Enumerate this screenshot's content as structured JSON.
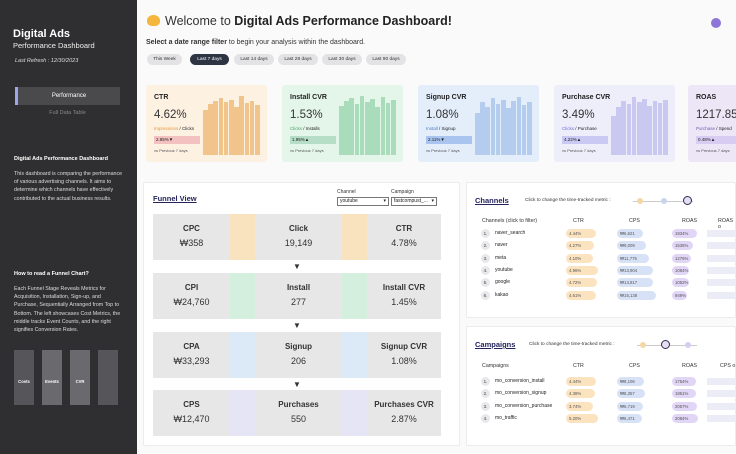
{
  "sidebar": {
    "title": "Digital Ads",
    "subtitle": "Performance Dashboard",
    "last_refresh": "Last Refresh : 12/30/2023",
    "nav": [
      "Performance",
      "Full Data Table"
    ],
    "about_title": "Digital Ads Performance Dashboard",
    "about_text": "This dashboard is comparing the performance of various advertising channels. It aims to determine which channels have effectively contributed to the actual business results.",
    "funnel_title": "How to read a Funnel Chart?",
    "funnel_text": "Each Funnel Stage Reveals Metrics for Acquisition, Installation, Sign-up, and Purchase, Sequentially Arranged from Top to Bottom. The left showcases Cost Metrics, the middle tracks Event Counts, and the right signifies Conversion Rates.",
    "mini_labels": [
      "Costs",
      "Events",
      "CVR"
    ]
  },
  "header": {
    "welcome_prefix": "Welcome to",
    "welcome_title": "Digital Ads Performance Dashboard!",
    "range_bold": "Select a date range filter",
    "range_rest": "to begin your analysis within the dashboard.",
    "ranges": [
      "This Week",
      "Last 7 days",
      "Last 14 days",
      "Last 28 days",
      "Last 30 days",
      "Last 90 days"
    ],
    "active_range": "Last 7 days"
  },
  "kpis": [
    {
      "name": "CTR",
      "value": "4.62%",
      "sub_a": "Impressions",
      "sub_b": "Clicks",
      "chip": "2.85%▼",
      "vs": "vs Previous 7 days",
      "bg": "#fdf1e2",
      "bar": "#f1c48c",
      "chipbg": "#f4c1c1",
      "accent": "#e39a3a",
      "bars": [
        0.75,
        0.85,
        0.9,
        0.95,
        0.88,
        0.92,
        0.8,
        0.98,
        0.86,
        0.9,
        0.83
      ]
    },
    {
      "name": "Install CVR",
      "value": "1.53%",
      "sub_a": "Clicks",
      "sub_b": "Installs",
      "chip": "1.95%▲",
      "vs": "vs Previous 7 days",
      "bg": "#e4f6ea",
      "bar": "#a9dcba",
      "chipbg": "#b6ddc5",
      "accent": "#4a9e64",
      "bars": [
        0.82,
        0.9,
        0.95,
        0.85,
        0.98,
        0.88,
        0.93,
        0.8,
        0.96,
        0.87,
        0.91
      ]
    },
    {
      "name": "Signup CVR",
      "value": "1.08%",
      "sub_a": "Install",
      "sub_b": "Signup",
      "chip": "2.11%▼",
      "vs": "vs Previous 7 days",
      "bg": "#e4eefb",
      "bar": "#b4cdef",
      "chipbg": "#a9c5ef",
      "accent": "#4f7cc8",
      "bars": [
        0.7,
        0.88,
        0.8,
        0.95,
        0.85,
        0.92,
        0.78,
        0.9,
        0.97,
        0.83,
        0.88
      ]
    },
    {
      "name": "Purchase CVR",
      "value": "3.49%",
      "sub_a": "Clicks",
      "sub_b": "Purchase",
      "chip": "4.22%▲",
      "vs": "vs Previous 7 days",
      "bg": "#eeeefb",
      "bar": "#c8c8f0",
      "chipbg": "#c9c9f3",
      "accent": "#6a6ad0",
      "bars": [
        0.65,
        0.8,
        0.9,
        0.85,
        0.97,
        0.88,
        0.94,
        0.82,
        0.9,
        0.86,
        0.92
      ]
    },
    {
      "name": "ROAS",
      "value": "1217.85%",
      "sub_a": "Purchase",
      "sub_b": "Spend",
      "chip": "0.48%▲",
      "vs": "vs Previous 7 days",
      "bg": "#ece6f7",
      "bar": "#d3c6ee",
      "chipbg": "#d9ccf3",
      "accent": "#7a59b8",
      "bars": []
    }
  ],
  "funnel": {
    "title": "Funnel View",
    "channel_label": "Channel",
    "channel_value": "youtube",
    "campaign_label": "Campaign",
    "campaign_value": "fastcompust_...",
    "rows": [
      {
        "cost_label": "CPC",
        "cost_value": "₩358",
        "event_label": "Click",
        "event_value": "19,149",
        "rate_label": "CTR",
        "rate_value": "4.78%",
        "accent": "#f8e3be"
      },
      {
        "cost_label": "CPI",
        "cost_value": "₩24,760",
        "event_label": "Install",
        "event_value": "277",
        "rate_label": "Install CVR",
        "rate_value": "1.45%",
        "accent": "#d4efdd"
      },
      {
        "cost_label": "CPA",
        "cost_value": "₩33,293",
        "event_label": "Signup",
        "event_value": "206",
        "rate_label": "Signup CVR",
        "rate_value": "1.08%",
        "accent": "#dceaf7"
      },
      {
        "cost_label": "CPS",
        "cost_value": "₩12,470",
        "event_label": "Purchases",
        "event_value": "550",
        "rate_label": "Purchases CVR",
        "rate_value": "2.87%",
        "accent": "#e5e5f6"
      }
    ],
    "arrow": "▼"
  },
  "channels": {
    "title": "Channels",
    "hint": "Click to change the time-tracked metric :",
    "headers": [
      "Channels  (click to filter)",
      "CTR",
      "CPS",
      "ROAS",
      "ROAS o"
    ],
    "rows": [
      {
        "n": "1.",
        "name": "naver_search",
        "ctr": "4.44%",
        "cps": "₩6,621",
        "roas": "1934%",
        "ctr_w": 0.55,
        "cps_w": 0.4,
        "roas_w": 0.85
      },
      {
        "n": "2.",
        "name": "naver",
        "ctr": "4.27%",
        "cps": "₩9,009",
        "roas": "1535%",
        "ctr_w": 0.5,
        "cps_w": 0.5,
        "roas_w": 0.7
      },
      {
        "n": "3.",
        "name": "meta",
        "ctr": "4.10%",
        "cps": "₩11,775",
        "roas": "1276%",
        "ctr_w": 0.48,
        "cps_w": 0.6,
        "roas_w": 0.6
      },
      {
        "n": "4.",
        "name": "youtube",
        "ctr": "4.96%",
        "cps": "₩13,904",
        "roas": "1084%",
        "ctr_w": 0.62,
        "cps_w": 0.7,
        "roas_w": 0.5
      },
      {
        "n": "5.",
        "name": "google",
        "ctr": "4.72%",
        "cps": "₩13,817",
        "roas": "1052%",
        "ctr_w": 0.58,
        "cps_w": 0.7,
        "roas_w": 0.48
      },
      {
        "n": "6.",
        "name": "kakao",
        "ctr": "4.61%",
        "cps": "₩15,138",
        "roas": "949%",
        "ctr_w": 0.56,
        "cps_w": 0.78,
        "roas_w": 0.42
      }
    ]
  },
  "campaigns": {
    "title": "Campaigns",
    "hint": "Click to change the time-tracked metric :",
    "headers": [
      "Campaigns",
      "CTR",
      "CPS",
      "ROAS",
      "CPS o"
    ],
    "rows": [
      {
        "n": "1.",
        "name": "mo_conversion_install",
        "ctr": "4.44%",
        "cps": "₩8,106",
        "roas": "1754%",
        "ctr_w": 0.55,
        "cps_w": 0.45,
        "roas_w": 0.8
      },
      {
        "n": "2.",
        "name": "mo_conversion_signup",
        "ctr": "4.38%",
        "cps": "₩8,357",
        "roas": "1851%",
        "ctr_w": 0.54,
        "cps_w": 0.47,
        "roas_w": 0.82
      },
      {
        "n": "3.",
        "name": "mo_conversion_purchase",
        "ctr": "3.74%",
        "cps": "₩6,719",
        "roas": "2057%",
        "ctr_w": 0.46,
        "cps_w": 0.4,
        "roas_w": 0.88
      },
      {
        "n": "4.",
        "name": "mo_traffic",
        "ctr": "5.20%",
        "cps": "₩6,471",
        "roas": "2084%",
        "ctr_w": 0.64,
        "cps_w": 0.38,
        "roas_w": 0.9
      }
    ]
  }
}
